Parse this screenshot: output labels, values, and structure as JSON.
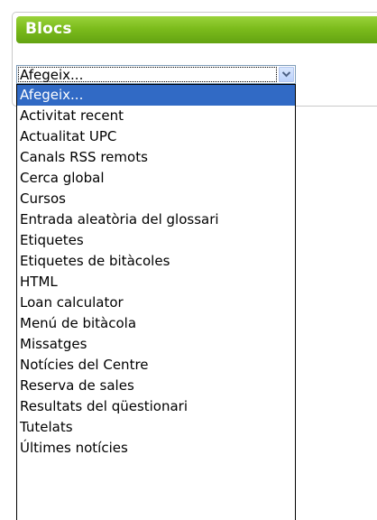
{
  "block": {
    "title": "Blocs"
  },
  "select": {
    "current_value": "Afegeix...",
    "options": [
      "Afegeix...",
      "Activitat recent",
      "Actualitat UPC",
      "Canals RSS remots",
      "Cerca global",
      "Cursos",
      "Entrada aleatòria del glossari",
      "Etiquetes",
      "Etiquetes de bitàcoles",
      "HTML",
      "Loan calculator",
      "Menú de bitàcola",
      "Missatges",
      "Notícies del Centre",
      "Reserva de sales",
      "Resultats del qüestionari",
      "Tutelats",
      "Últimes notícies"
    ],
    "highlighted_option": "Afegeix..."
  },
  "colors": {
    "header_green": "#7cbc1c",
    "highlight_blue": "#316ac5"
  },
  "icons": {
    "dropdown_button": "chevron-down-icon"
  }
}
